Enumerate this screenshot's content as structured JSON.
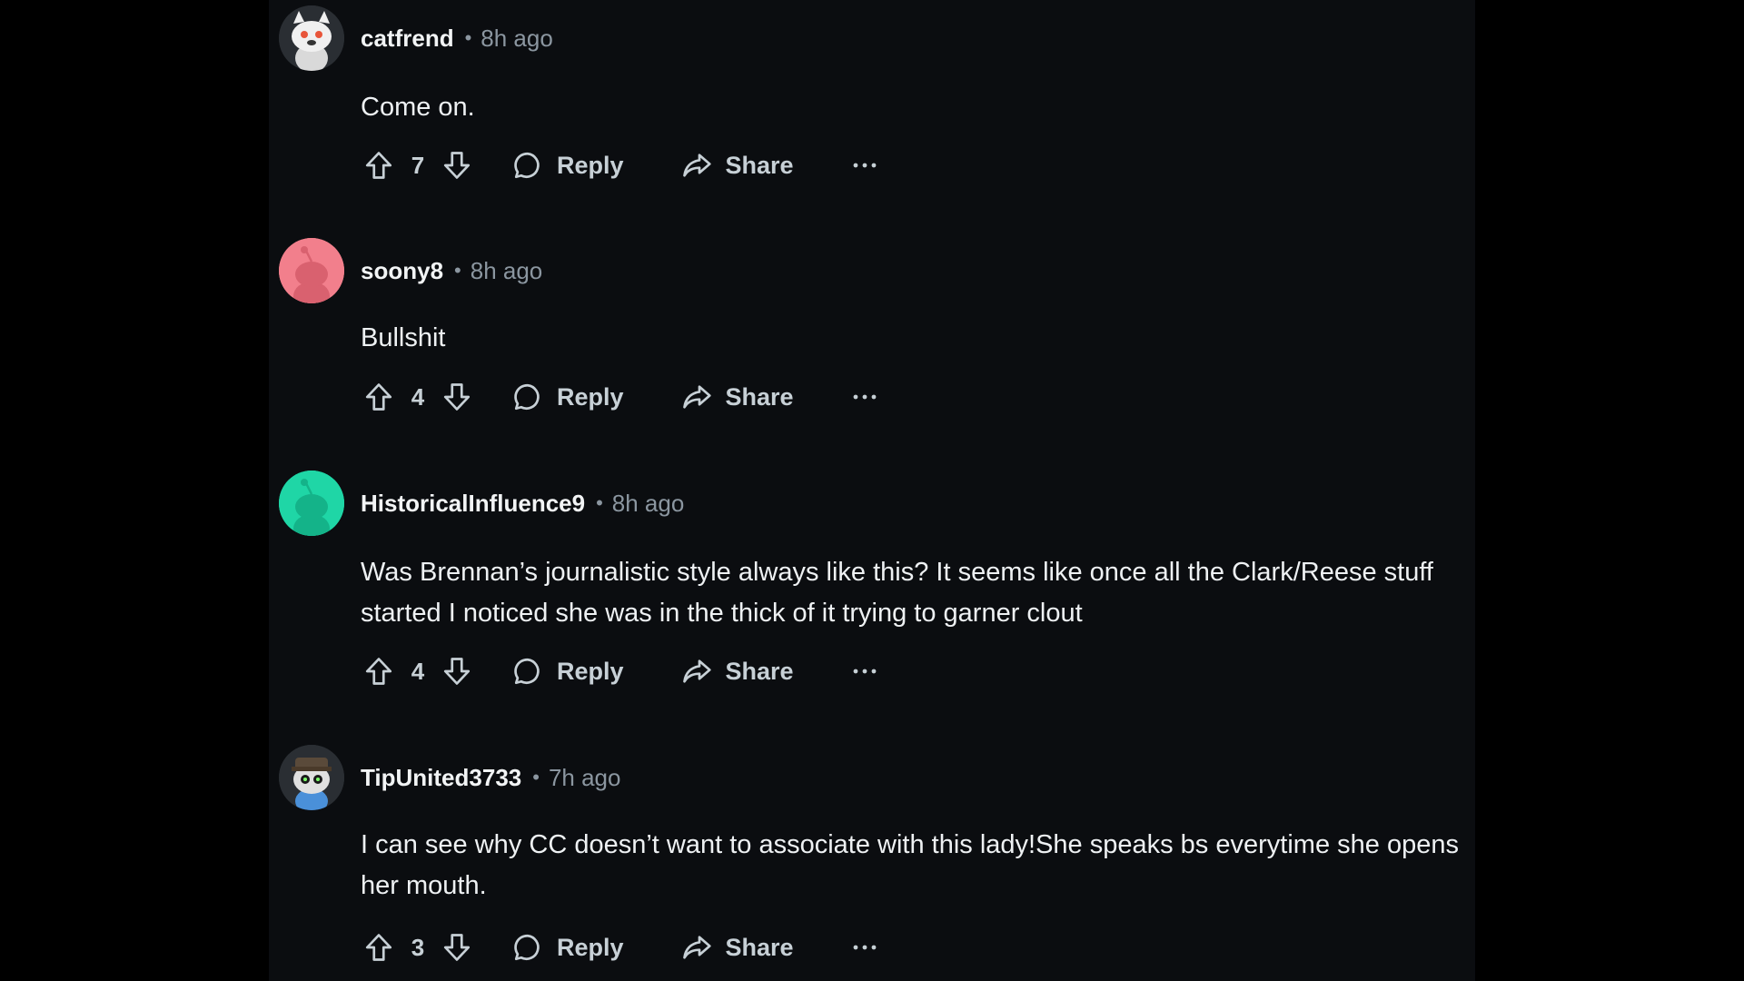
{
  "comments": [
    {
      "username": "catfrend",
      "separator": "•",
      "time": "8h ago",
      "body": "Come on.",
      "votes": "7",
      "reply_label": "Reply",
      "share_label": "Share",
      "more_label": "···",
      "avatar_color": "#e9e9e9"
    },
    {
      "username": "soony8",
      "separator": "•",
      "time": "8h ago",
      "body": "Bullshit",
      "votes": "4",
      "reply_label": "Reply",
      "share_label": "Share",
      "more_label": "···",
      "avatar_color": "#f27f8c"
    },
    {
      "username": "HistoricalInfluence9",
      "separator": "•",
      "time": "8h ago",
      "body": "Was Brennan’s journalistic style always like this? It seems like once all the Clark/Reese stuff started I noticed she was in the thick of it trying to garner clout",
      "votes": "4",
      "reply_label": "Reply",
      "share_label": "Share",
      "more_label": "···",
      "avatar_color": "#1fd6a6"
    },
    {
      "username": "TipUnited3733",
      "separator": "•",
      "time": "7h ago",
      "body": "I can see why CC doesn’t want to associate with this lady!She speaks bs everytime she opens her mouth.",
      "votes": "3",
      "reply_label": "Reply",
      "share_label": "Share",
      "more_label": "···",
      "avatar_color": "#3b4148"
    }
  ],
  "colors": {
    "page_background": "#000000",
    "panel_background": "#0b0d10",
    "text_primary": "#eef1f3",
    "text_secondary": "#8b96a0",
    "action_text": "#c7d0d6"
  }
}
